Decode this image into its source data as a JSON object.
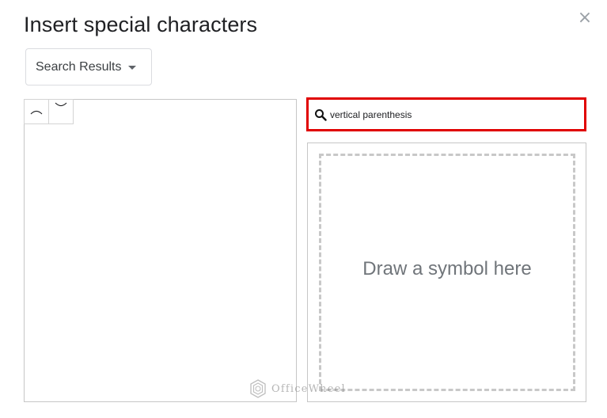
{
  "dialog": {
    "title": "Insert special characters",
    "close_glyph": "×"
  },
  "category_dropdown": {
    "selected": "Search Results"
  },
  "results": {
    "characters": [
      {
        "glyph": "⁀",
        "name": "character tie"
      },
      {
        "glyph": "‿",
        "name": "undertie"
      }
    ]
  },
  "search": {
    "value": "vertical parenthesis",
    "icon": "search-icon"
  },
  "draw_area": {
    "label": "Draw a symbol here"
  },
  "watermark": {
    "text": "OfficeWheel"
  },
  "colors": {
    "highlight": "#e00000",
    "border": "#c6c6c6",
    "text": "#202124",
    "muted": "#70757a"
  }
}
